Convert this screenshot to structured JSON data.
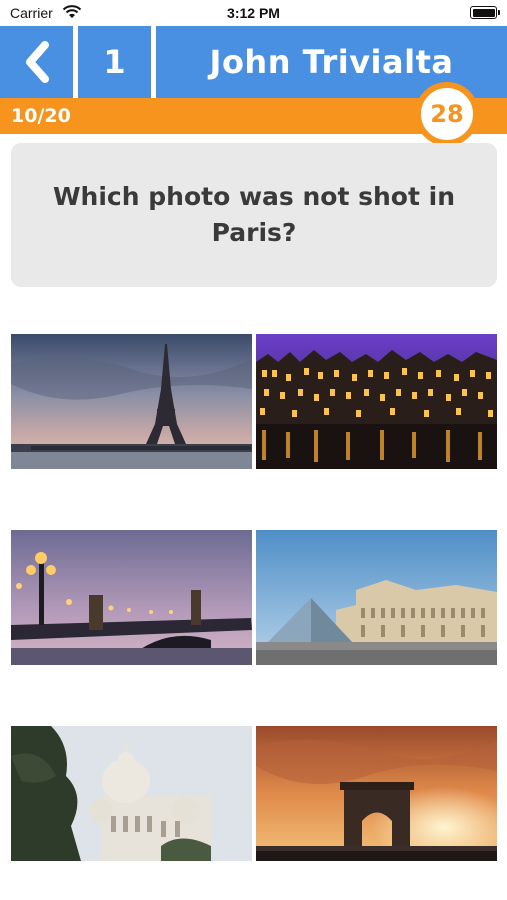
{
  "status_bar": {
    "carrier": "Carrier",
    "time": "3:12 PM"
  },
  "header": {
    "level": "1",
    "title": "John Trivialta"
  },
  "progress": {
    "label": "10/20",
    "fraction": 0.5,
    "score": "28"
  },
  "question": {
    "text": "Which photo was not shot in Paris?"
  },
  "answers": [
    {
      "icon": "eiffel-tower-photo"
    },
    {
      "icon": "amsterdam-canal-houses-photo"
    },
    {
      "icon": "pont-alexandre-iii-bridge-photo"
    },
    {
      "icon": "louvre-pyramid-photo"
    },
    {
      "icon": "sacre-coeur-basilica-photo"
    },
    {
      "icon": "arc-de-triomphe-photo"
    }
  ],
  "colors": {
    "header_blue": "#4a90e2",
    "progress_orange": "#f7941d",
    "question_bg": "#e9e9e9",
    "question_text": "#3a3a3a"
  }
}
